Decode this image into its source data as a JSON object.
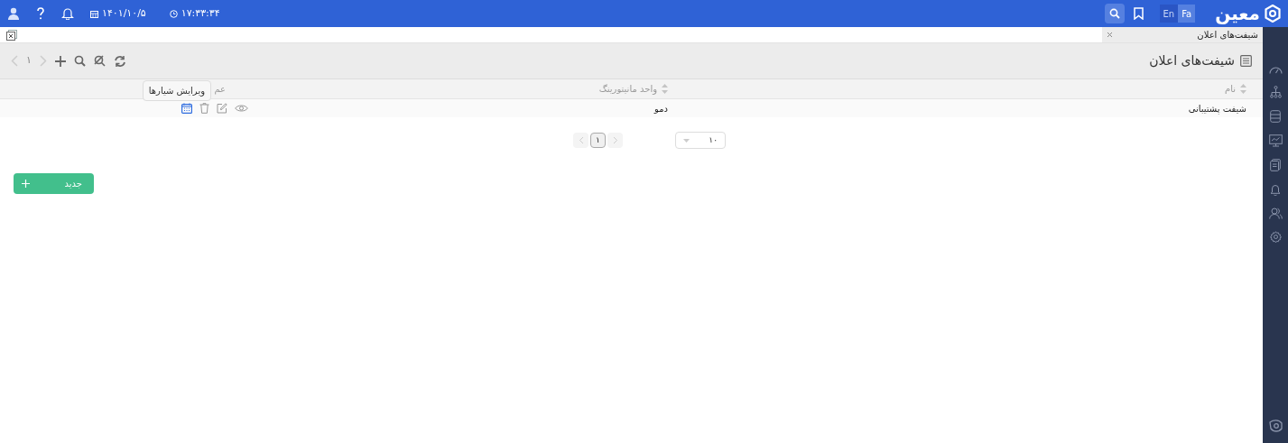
{
  "header": {
    "logo": "معین",
    "languages": [
      {
        "label": "Fa",
        "selected": true
      },
      {
        "label": "En",
        "selected": false
      }
    ],
    "date": "۱۴۰۱/۱۰/۵",
    "time": "۱۷:۳۳:۳۴"
  },
  "tabs": [
    {
      "label": "شیفت‌های اعلان",
      "selected": true
    }
  ],
  "page": {
    "title": "شیفت‌های اعلان",
    "toolbar_page": "۱"
  },
  "table": {
    "columns": [
      "نام",
      "واحد مانیتورینگ",
      "عم"
    ],
    "rows": [
      {
        "name": "شیفت پشتیبانی",
        "unit": "دمو"
      }
    ],
    "tooltip": "ویرایش شیارها"
  },
  "pagination": {
    "page_size": "۱۰",
    "pages": [
      {
        "label": "۱",
        "selected": true
      }
    ]
  },
  "new_button": "جدید"
}
